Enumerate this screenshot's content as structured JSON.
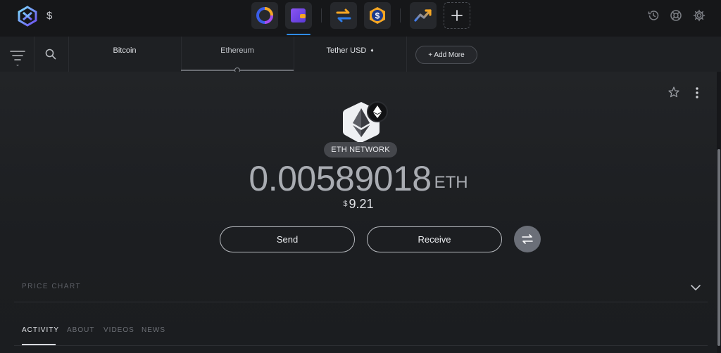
{
  "topbar": {
    "logo_icon": "exodus-logo-icon",
    "currency_symbol": "$",
    "apps": [
      {
        "name": "portfolio-app",
        "icon": "portfolio-ring-icon"
      },
      {
        "name": "wallet-app",
        "icon": "wallet-icon",
        "active": true
      },
      {
        "name": "exchange-app",
        "icon": "exchange-arrows-icon"
      },
      {
        "name": "stablecoin-app",
        "icon": "dollar-coin-icon"
      },
      {
        "name": "trading-app",
        "icon": "trend-up-icon"
      },
      {
        "name": "add-app",
        "icon": "plus-icon"
      }
    ],
    "right_icons": [
      "history-icon",
      "support-lifebuoy-icon",
      "settings-gear-icon"
    ]
  },
  "asset_tabs": {
    "tabs": [
      {
        "label": "Bitcoin"
      },
      {
        "label": "Ethereum",
        "active": true
      },
      {
        "label": "Tether USD",
        "badge_icon": "ethereum-diamond-icon"
      }
    ],
    "add_more_label": "+ Add More"
  },
  "asset": {
    "network_badge": "ETH NETWORK",
    "balance": "0.00589018",
    "unit": "ETH",
    "fiat_symbol": "$",
    "fiat_value": "9.21",
    "send_label": "Send",
    "receive_label": "Receive"
  },
  "price_chart": {
    "label": "PRICE CHART"
  },
  "bottom_tabs": [
    {
      "label": "ACTIVITY",
      "active": true
    },
    {
      "label": "ABOUT"
    },
    {
      "label": "VIDEOS"
    },
    {
      "label": "NEWS"
    }
  ],
  "colors": {
    "background": "#1b1d20",
    "accent": "#2f8ce6",
    "wallet_purple": "#7b4de8",
    "exchange_orange": "#f5a623",
    "exchange_blue": "#2d7be6"
  }
}
